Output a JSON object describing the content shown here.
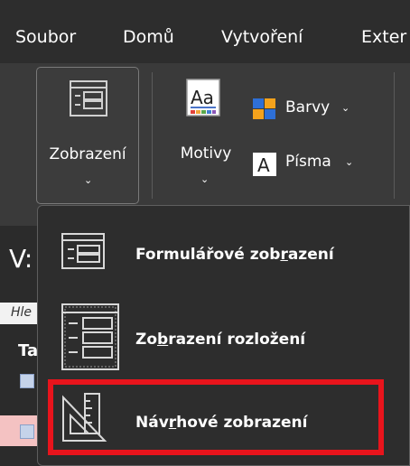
{
  "menubar": {
    "tabs": [
      {
        "label": "Soubor"
      },
      {
        "label": "Domů"
      },
      {
        "label": "Vytvoření"
      },
      {
        "label": "Exter"
      }
    ]
  },
  "ribbon": {
    "views_button": {
      "label": "Zobrazení",
      "icon": "form-view-icon"
    },
    "themes_button": {
      "label": "Motivy",
      "icon": "themes-aa-icon"
    },
    "colors_button": {
      "label": "Barvy",
      "icon": "colors-palette-icon"
    },
    "fonts_button": {
      "label": "Písma",
      "icon": "fonts-a-icon"
    }
  },
  "background": {
    "v_text": "V:",
    "hle_text": "Hle",
    "ta_text": "Ta"
  },
  "dropdown": {
    "items": [
      {
        "label_pre": "Formulářové zob",
        "label_ul": "r",
        "label_post": "azení",
        "icon": "form-view-icon"
      },
      {
        "label_pre": "Zo",
        "label_ul": "b",
        "label_post": "razení rozložení",
        "icon": "layout-view-icon"
      },
      {
        "label_pre": "Náv",
        "label_ul": "r",
        "label_post": "hové zobrazení",
        "icon": "design-view-icon"
      }
    ],
    "highlighted_item": "Návrhové zobrazení",
    "highlight_color": "#e8141c"
  },
  "colors": {
    "menubar_bg": "#2d2d2d",
    "ribbon_bg": "#3a3a3a",
    "dropdown_bg": "#2d2d2d",
    "text": "#ffffff"
  }
}
